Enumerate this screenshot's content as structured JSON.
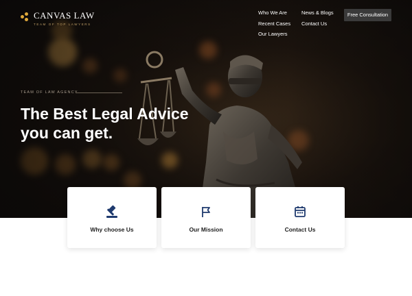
{
  "brand": {
    "name": "CANVAS LAW",
    "tagline": "TEAM OF TOP LAWYERS"
  },
  "nav": {
    "col1": [
      "Who We Are",
      "Recent Cases",
      "Our Lawyers"
    ],
    "col2": [
      "News & Blogs",
      "Contact Us"
    ]
  },
  "cta_label": "Free Consultation",
  "hero": {
    "eyebrow": "TEAM OF LAW AGENCY",
    "headline_line1": "The Best Legal Advice",
    "headline_line2": "you can get."
  },
  "cards": [
    {
      "label": "Why choose Us",
      "icon": "gavel-icon"
    },
    {
      "label": "Our Mission",
      "icon": "flag-icon"
    },
    {
      "label": "Contact Us",
      "icon": "calendar-icon"
    }
  ],
  "colors": {
    "accent_gold": "#e0a93b",
    "icon_navy": "#1f3a6e",
    "cta_bg": "#3a3a3a"
  }
}
